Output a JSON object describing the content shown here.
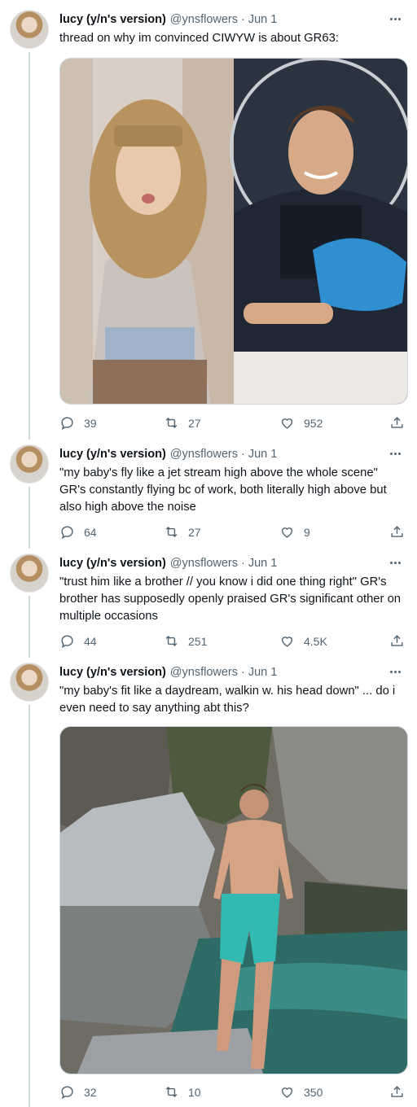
{
  "author": {
    "name": "lucy (y/n's version)",
    "handle": "@ynsflowers",
    "separator": "·",
    "date": "Jun 1"
  },
  "tweets": [
    {
      "text": "thread on why im convinced CIWYW is about GR63:",
      "stats": {
        "replies": "39",
        "retweets": "27",
        "likes": "952"
      }
    },
    {
      "text": "\"my baby's fly like a jet stream high above the whole scene\" GR's constantly flying bc of work, both literally high above but also high above the noise",
      "stats": {
        "replies": "64",
        "retweets": "27",
        "likes": "9"
      }
    },
    {
      "text": "\"trust him like a brother // you know i did one thing right\" GR's brother has supposedly openly praised GR's significant other on multiple occasions",
      "stats": {
        "replies": "44",
        "retweets": "251",
        "likes": "4.5K"
      }
    },
    {
      "text": "\"my baby's fit like a daydream, walkin w. his head down\" ... do i even need to say anything abt this?",
      "stats": {
        "replies": "32",
        "retweets": "10",
        "likes": "350"
      }
    }
  ],
  "colors": {
    "text": "#0f1419",
    "secondary": "#536471",
    "border": "#cfd9de"
  },
  "icons": [
    "reply-icon",
    "retweet-icon",
    "like-icon",
    "share-icon",
    "more-icon"
  ]
}
